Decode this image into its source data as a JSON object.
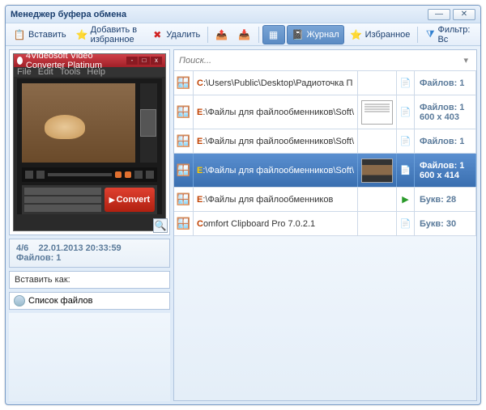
{
  "title": "Менеджер буфера обмена",
  "toolbar": {
    "paste": "Вставить",
    "fav": "Добавить в избранное",
    "del": "Удалить",
    "journal": "Журнал",
    "favorites": "Избранное",
    "filter": "Фильтр: Вс"
  },
  "preview": {
    "app_title": "4Videosoft Video Converter Platinum",
    "menu": [
      "File",
      "Edit",
      "Tools",
      "Help"
    ],
    "convert": "Convert"
  },
  "info": {
    "index": "4/6",
    "date": "22.01.2013 20:33:59",
    "files": "Файлов: 1"
  },
  "insert_label": "Вставить как:",
  "filelist_label": "Список файлов",
  "search_placeholder": "Поиск...",
  "items": [
    {
      "path_pre": "C",
      "path": ":\\Users\\Public\\Desktop\\Радиоточка П",
      "meta1": "Файлов: 1",
      "meta2": "",
      "thumb": "none",
      "icon": "file",
      "sel": false,
      "h": "small"
    },
    {
      "path_pre": "E",
      "path": ":\\Файлы для файлообменников\\Soft\\",
      "meta1": "Файлов: 1",
      "meta2": "600 x 403",
      "thumb": "doc",
      "icon": "file",
      "sel": false,
      "h": ""
    },
    {
      "path_pre": "E",
      "path": ":\\Файлы для файлообменников\\Soft\\",
      "meta1": "Файлов: 1",
      "meta2": "",
      "thumb": "none",
      "icon": "file",
      "sel": false,
      "h": "small"
    },
    {
      "path_pre": "E",
      "path": ":\\Файлы для файлообменников\\Soft\\",
      "meta1": "Файлов: 1",
      "meta2": "600 x 414",
      "thumb": "app",
      "icon": "file",
      "sel": true,
      "h": ""
    },
    {
      "path_pre": "E",
      "path": ":\\Файлы для файлообменников",
      "meta1": "Букв: 28",
      "meta2": "",
      "thumb": "none",
      "icon": "play",
      "sel": false,
      "h": "small"
    },
    {
      "path_pre": "C",
      "path": "omfort Clipboard Pro 7.0.2.1",
      "meta1": "Букв: 30",
      "meta2": "",
      "thumb": "none",
      "icon": "file",
      "sel": false,
      "h": "small"
    }
  ]
}
